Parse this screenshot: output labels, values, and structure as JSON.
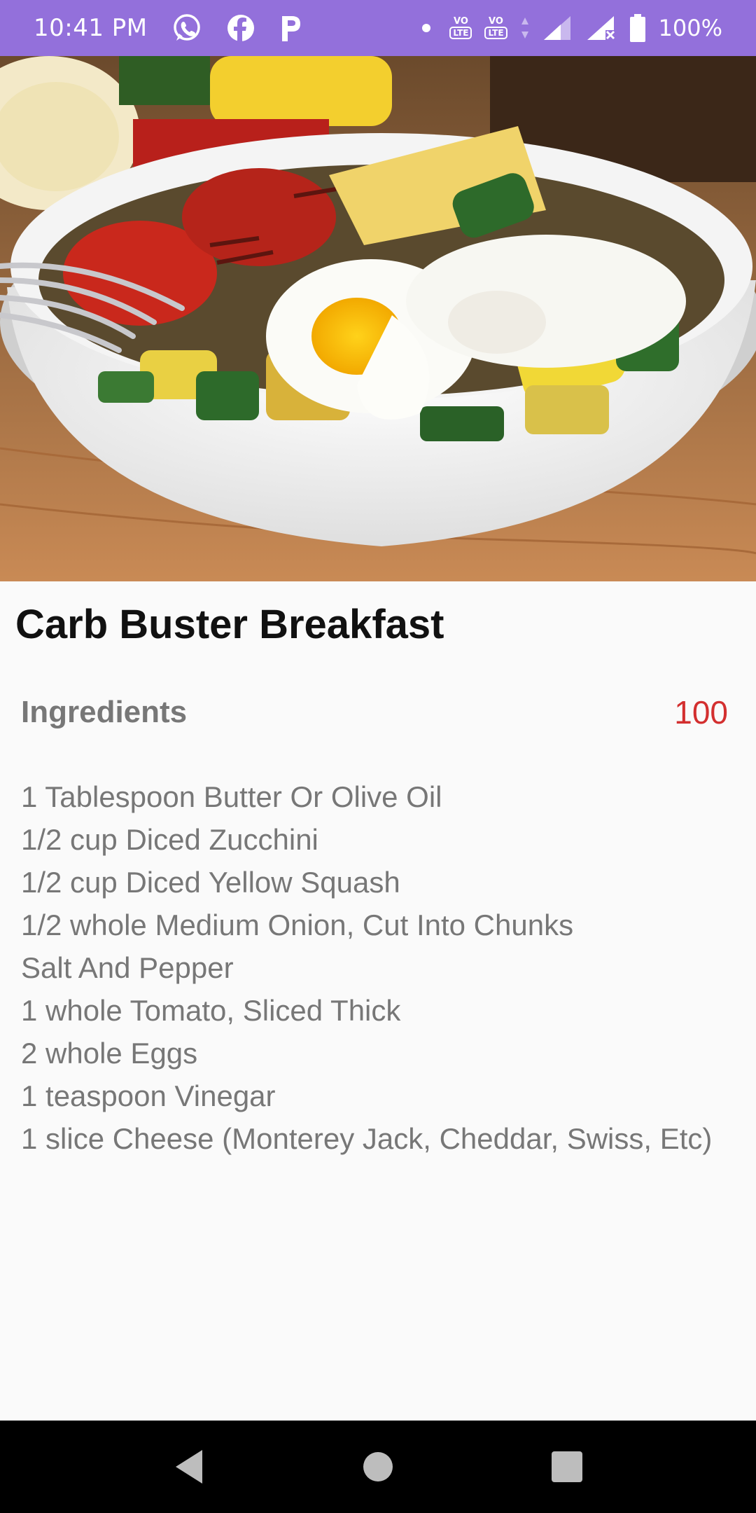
{
  "status_bar": {
    "time": "10:41 PM",
    "battery_percent": "100%",
    "notification_icons": [
      "whatsapp-icon",
      "facebook-icon",
      "p-icon"
    ],
    "lte1_label": "VO",
    "lte1_sub": "LTE",
    "lte2_label": "VO",
    "lte2_sub": "LTE"
  },
  "recipe": {
    "title": "Carb Buster Breakfast",
    "ingredients_label": "Ingredients",
    "ingredients_count": "100",
    "ingredients": [
      "1 Tablespoon Butter Or Olive Oil",
      "1/2 cup Diced Zucchini",
      "1/2 cup Diced Yellow Squash",
      "1/2 whole Medium Onion, Cut Into Chunks",
      "Salt And Pepper",
      "1 whole Tomato, Sliced Thick",
      "2 whole Eggs",
      "1 teaspoon Vinegar",
      "1 slice Cheese (Monterey Jack, Cheddar, Swiss, Etc)"
    ]
  },
  "colors": {
    "status_bar": "#9370db",
    "count_accent": "#d32f2f",
    "text_secondary": "#777777"
  },
  "nav_bar": {
    "icons": [
      "back-icon",
      "home-icon",
      "recents-icon"
    ]
  }
}
